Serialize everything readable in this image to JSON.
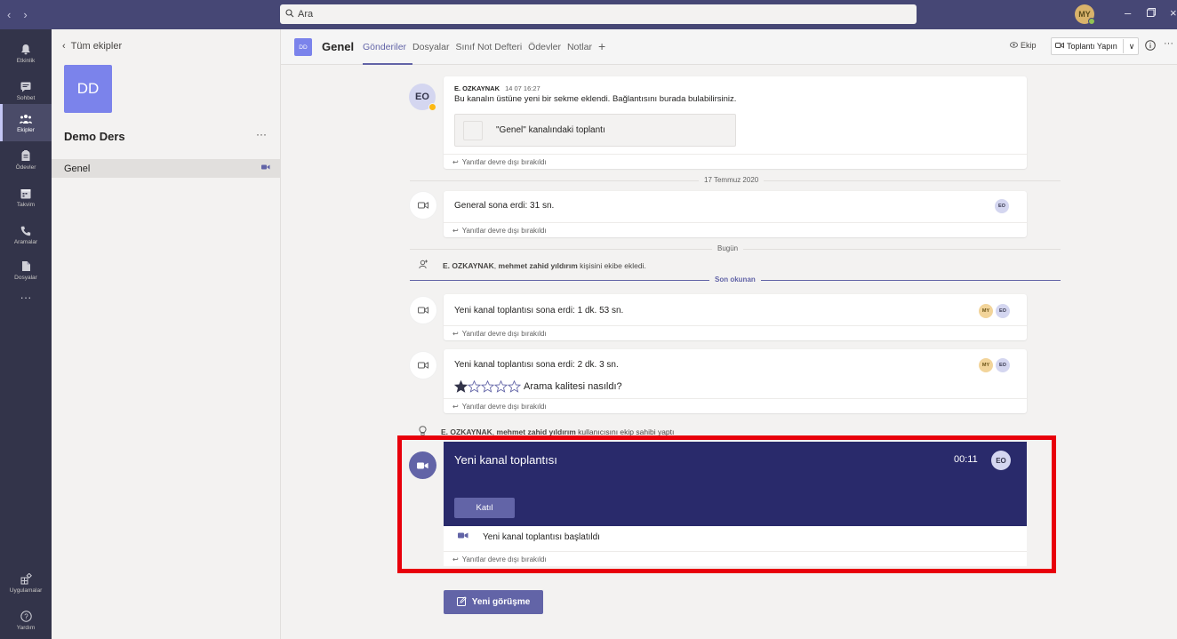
{
  "search": {
    "placeholder": "Ara"
  },
  "user": {
    "initials": "MY"
  },
  "appbar": {
    "items": [
      {
        "label": "Etkinlik",
        "icon": "bell-icon"
      },
      {
        "label": "Sohbet",
        "icon": "chat-icon"
      },
      {
        "label": "Ekipler",
        "icon": "teams-icon"
      },
      {
        "label": "Ödevler",
        "icon": "assignments-icon"
      },
      {
        "label": "Takvim",
        "icon": "calendar-icon"
      },
      {
        "label": "Aramalar",
        "icon": "phone-icon"
      },
      {
        "label": "Dosyalar",
        "icon": "files-icon"
      }
    ],
    "more": "···",
    "apps_label": "Uygulamalar",
    "help_label": "Yardım"
  },
  "leftpane": {
    "back_label": "Tüm ekipler",
    "team_initials": "DD",
    "team_name": "Demo Ders",
    "more": "···",
    "channel": "Genel"
  },
  "header": {
    "channel_initials": "DD",
    "channel_name": "Genel",
    "tabs": [
      "Gönderiler",
      "Dosyalar",
      "Sınıf Not Defteri",
      "Ödevler",
      "Notlar"
    ],
    "team_label": "Ekip",
    "meet_label": "Toplantı Yapın",
    "more": "···"
  },
  "messages": {
    "post1": {
      "avatar": "EO",
      "author": "E. OZKAYNAK",
      "time": "14 07 16:27",
      "body": "Bu kanalın üstüne yeni bir sekme eklendi. Bağlantısını burada bulabilirsiniz.",
      "attachment": "\"Genel\" kanalındaki toplantı",
      "reply": "Yanıtlar devre dışı bırakıldı"
    },
    "date1": "17 Temmuz 2020",
    "meet1": {
      "text": "General sona erdi: 31 sn.",
      "avatar": "EO",
      "reply": "Yanıtlar devre dışı bırakıldı"
    },
    "date2": "Bugün",
    "sys1": {
      "actor": "E. OZKAYNAK",
      "target": "mehmet zahid yıldırım",
      "text": "kişisini ekibe ekledi."
    },
    "last_read": "Son okunan",
    "meet2": {
      "text": "Yeni kanal toplantısı sona erdi: 1 dk. 53 sn.",
      "avatars": [
        "MY",
        "EO"
      ],
      "reply": "Yanıtlar devre dışı bırakıldı"
    },
    "meet3": {
      "text": "Yeni kanal toplantısı sona erdi: 2 dk. 3 sn.",
      "avatars": [
        "MY",
        "EO"
      ],
      "rating_prompt": "Arama kalitesi nasıldı?",
      "rating_value": 1,
      "rating_max": 5,
      "reply": "Yanıtlar devre dışı bırakıldı"
    },
    "sys2": {
      "actor": "E. OZKAYNAK",
      "target": "mehmet zahid yıldırım",
      "text": "kullanıcısını ekip sahibi yaptı"
    }
  },
  "active_meeting": {
    "title": "Yeni kanal toplantısı",
    "timer": "00:11",
    "avatar": "EO",
    "join_label": "Katıl",
    "started_text": "Yeni kanal toplantısı başlatıldı",
    "reply": "Yanıtlar devre dışı bırakıldı"
  },
  "new_conversation_label": "Yeni görüşme",
  "colors": {
    "titlebar": "#464775",
    "appbar": "#33344a",
    "brand": "#6264a7",
    "meeting_banner": "#292a6b",
    "highlight_box": "#e8000b"
  }
}
